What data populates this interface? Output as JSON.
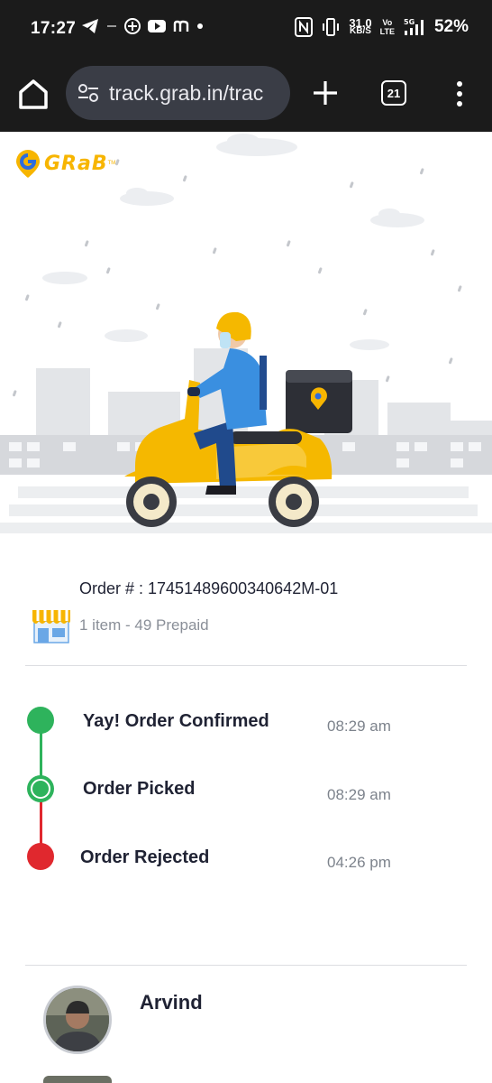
{
  "status_bar": {
    "time": "17:27",
    "network_speed_value": "31.0",
    "network_speed_unit": "KB/S",
    "volte_top": "Vo",
    "volte_bottom": "LTE",
    "network_type": "5G",
    "battery": "52%"
  },
  "browser": {
    "url": "track.grab.in/trac",
    "tab_count": "21"
  },
  "brand": {
    "logo_text": "GRaB",
    "trademark": "TM",
    "accent_color": "#f7b500"
  },
  "order": {
    "number_label": "Order # : 17451489600340642M-01",
    "summary": "1 item - 49 Prepaid"
  },
  "timeline": [
    {
      "label": "Yay! Order Confirmed",
      "time": "08:29 am",
      "status": "completed",
      "color": "#2eb35c"
    },
    {
      "label": "Order Picked",
      "time": "08:29 am",
      "status": "completed",
      "color": "#2eb35c"
    },
    {
      "label": "Order Rejected",
      "time": "04:26 pm",
      "status": "rejected",
      "color": "#e0282e"
    }
  ],
  "driver": {
    "name": "Arvind"
  }
}
